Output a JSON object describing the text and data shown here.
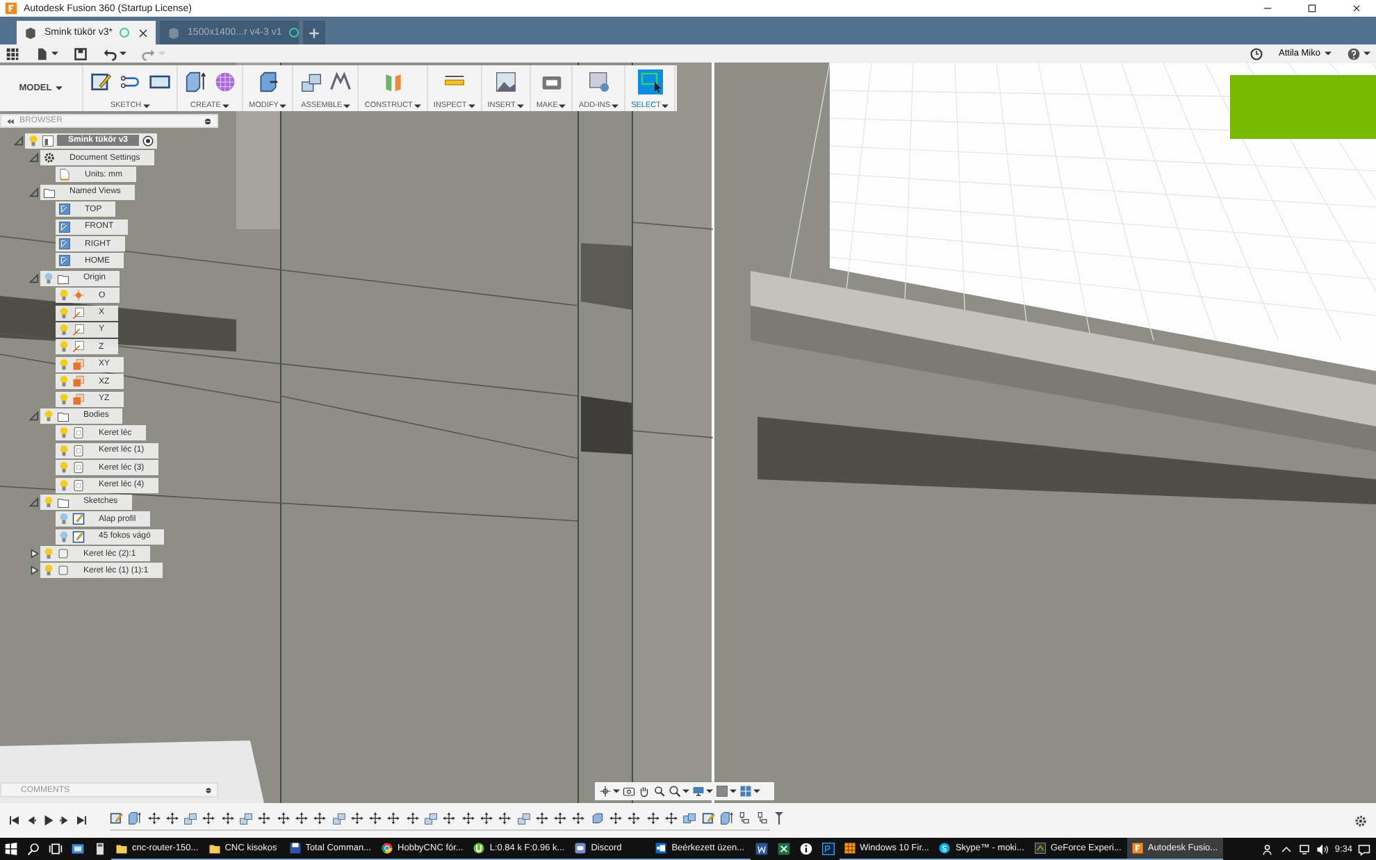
{
  "window": {
    "title": "Autodesk Fusion 360 (Startup License)"
  },
  "tabs": [
    {
      "label": "Smink tükör v3*",
      "selected": true
    },
    {
      "label": "1500x1400...r v4-3 v1",
      "selected": false
    }
  ],
  "quick_toolbar": {
    "user": "Attila Miko"
  },
  "toolbar": {
    "workspace": "MODEL",
    "groups": [
      {
        "label": "SKETCH",
        "selected": false,
        "tools": [
          {
            "kind": "sketch"
          },
          {
            "kind": "line"
          },
          {
            "kind": "rectangle"
          }
        ]
      },
      {
        "label": "CREATE",
        "selected": false,
        "tools": [
          {
            "kind": "extrude"
          },
          {
            "kind": "form"
          }
        ]
      },
      {
        "label": "MODIFY",
        "selected": false,
        "tools": [
          {
            "kind": "press-pull"
          }
        ]
      },
      {
        "label": "ASSEMBLE",
        "selected": false,
        "tools": [
          {
            "kind": "joint"
          },
          {
            "kind": "as-built"
          }
        ]
      },
      {
        "label": "CONSTRUCT",
        "selected": false,
        "tools": [
          {
            "kind": "plane"
          }
        ]
      },
      {
        "label": "INSPECT",
        "selected": false,
        "tools": [
          {
            "kind": "measure"
          }
        ]
      },
      {
        "label": "INSERT",
        "selected": false,
        "tools": [
          {
            "kind": "image"
          }
        ]
      },
      {
        "label": "MAKE",
        "selected": false,
        "tools": [
          {
            "kind": "printer"
          }
        ]
      },
      {
        "label": "ADD-INS",
        "selected": false,
        "tools": [
          {
            "kind": "scripts"
          }
        ]
      },
      {
        "label": "SELECT",
        "selected": true,
        "tools": [
          {
            "kind": "select"
          }
        ]
      }
    ]
  },
  "browser": {
    "title": "BROWSER",
    "tree": [
      {
        "label": "Smink tükör v3",
        "kind": "component",
        "visible": true,
        "expanded": true,
        "selected": true,
        "children": [
          {
            "label": "Document Settings",
            "kind": "settings",
            "expanded": true,
            "selected": false,
            "children": [
              {
                "label": "Units: mm",
                "kind": "units",
                "selected": false
              }
            ]
          },
          {
            "label": "Named Views",
            "kind": "folder",
            "expanded": true,
            "selected": false,
            "children": [
              {
                "label": "TOP",
                "kind": "view",
                "selected": false
              },
              {
                "label": "FRONT",
                "kind": "view",
                "selected": false
              },
              {
                "label": "RIGHT",
                "kind": "view",
                "selected": false
              },
              {
                "label": "HOME",
                "kind": "view",
                "selected": false
              }
            ]
          },
          {
            "label": "Origin",
            "kind": "folder",
            "visible": false,
            "expanded": true,
            "selected": false,
            "children": [
              {
                "label": "O",
                "kind": "point",
                "visible": true,
                "selected": false
              },
              {
                "label": "X",
                "kind": "axis",
                "visible": true,
                "selected": false
              },
              {
                "label": "Y",
                "kind": "axis",
                "visible": true,
                "selected": false
              },
              {
                "label": "Z",
                "kind": "axis",
                "visible": true,
                "selected": false
              },
              {
                "label": "XY",
                "kind": "plane",
                "visible": true,
                "selected": false
              },
              {
                "label": "XZ",
                "kind": "plane",
                "visible": true,
                "selected": false
              },
              {
                "label": "YZ",
                "kind": "plane",
                "visible": true,
                "selected": false
              }
            ]
          },
          {
            "label": "Bodies",
            "kind": "folder",
            "visible": true,
            "expanded": true,
            "selected": false,
            "children": [
              {
                "label": "Keret léc",
                "kind": "body",
                "visible": true,
                "selected": false
              },
              {
                "label": "Keret léc (1)",
                "kind": "body",
                "visible": true,
                "selected": false
              },
              {
                "label": "Keret léc (3)",
                "kind": "body",
                "visible": true,
                "selected": false
              },
              {
                "label": "Keret léc (4)",
                "kind": "body",
                "visible": true,
                "selected": false
              }
            ]
          },
          {
            "label": "Sketches",
            "kind": "folder",
            "visible": true,
            "expanded": true,
            "selected": false,
            "children": [
              {
                "label": "Alap profil",
                "kind": "sketch",
                "visible": false,
                "selected": false
              },
              {
                "label": "45 fokos vágó",
                "kind": "sketch",
                "visible": false,
                "selected": false
              }
            ]
          },
          {
            "label": "Keret léc (2):1",
            "kind": "occurrence",
            "visible": true,
            "expanded": false,
            "selected": false
          },
          {
            "label": "Keret léc (1) (1):1",
            "kind": "occurrence",
            "visible": true,
            "expanded": false,
            "selected": false
          }
        ]
      }
    ]
  },
  "comments": {
    "title": "COMMENTS"
  },
  "timeline": {
    "features": [
      {
        "kind": "sketch"
      },
      {
        "kind": "extrude"
      },
      {
        "kind": "move"
      },
      {
        "kind": "move"
      },
      {
        "kind": "joint"
      },
      {
        "kind": "move"
      },
      {
        "kind": "move"
      },
      {
        "kind": "joint"
      },
      {
        "kind": "move"
      },
      {
        "kind": "move"
      },
      {
        "kind": "move"
      },
      {
        "kind": "move"
      },
      {
        "kind": "joint"
      },
      {
        "kind": "move"
      },
      {
        "kind": "move"
      },
      {
        "kind": "move"
      },
      {
        "kind": "move"
      },
      {
        "kind": "joint"
      },
      {
        "kind": "move"
      },
      {
        "kind": "move"
      },
      {
        "kind": "move"
      },
      {
        "kind": "move"
      },
      {
        "kind": "joint"
      },
      {
        "kind": "move"
      },
      {
        "kind": "move"
      },
      {
        "kind": "move"
      },
      {
        "kind": "body"
      },
      {
        "kind": "move"
      },
      {
        "kind": "move"
      },
      {
        "kind": "move"
      },
      {
        "kind": "move"
      },
      {
        "kind": "combine"
      },
      {
        "kind": "sketch"
      },
      {
        "kind": "extrude"
      },
      {
        "kind": "rigid"
      },
      {
        "kind": "rigid"
      }
    ]
  },
  "taskbar": {
    "items": [
      {
        "kind": "windows"
      },
      {
        "kind": "search"
      },
      {
        "kind": "task-view"
      },
      {
        "kind": "mail"
      },
      {
        "kind": "calculator"
      },
      {
        "kind": "folder",
        "label": "cnc-router-150...",
        "selected": false
      },
      {
        "kind": "folder",
        "label": "CNC kisokos",
        "selected": false
      },
      {
        "kind": "floppy",
        "label": "Total Comman...",
        "selected": false
      },
      {
        "kind": "browser",
        "label": "HobbyCNC fór...",
        "selected": false
      },
      {
        "kind": "torrent",
        "label": "L:0.84 k F:0.96 k...",
        "selected": false
      },
      {
        "kind": "chat",
        "label": "Discord",
        "selected": false
      },
      {
        "kind": "outlook",
        "label": "Beérkezett üzen...",
        "selected": false
      },
      {
        "kind": "word"
      },
      {
        "kind": "excel"
      },
      {
        "kind": "info"
      },
      {
        "kind": "photoshop"
      },
      {
        "kind": "grid",
        "label": "Windows 10 Fir...",
        "selected": false
      },
      {
        "kind": "skype",
        "label": "Skype™ - moki...",
        "selected": false
      },
      {
        "kind": "geforce",
        "label": "GeForce Experi...",
        "selected": false
      },
      {
        "kind": "fusion",
        "label": "Autodesk Fusio...",
        "selected": true
      }
    ],
    "clock": "9:34"
  }
}
